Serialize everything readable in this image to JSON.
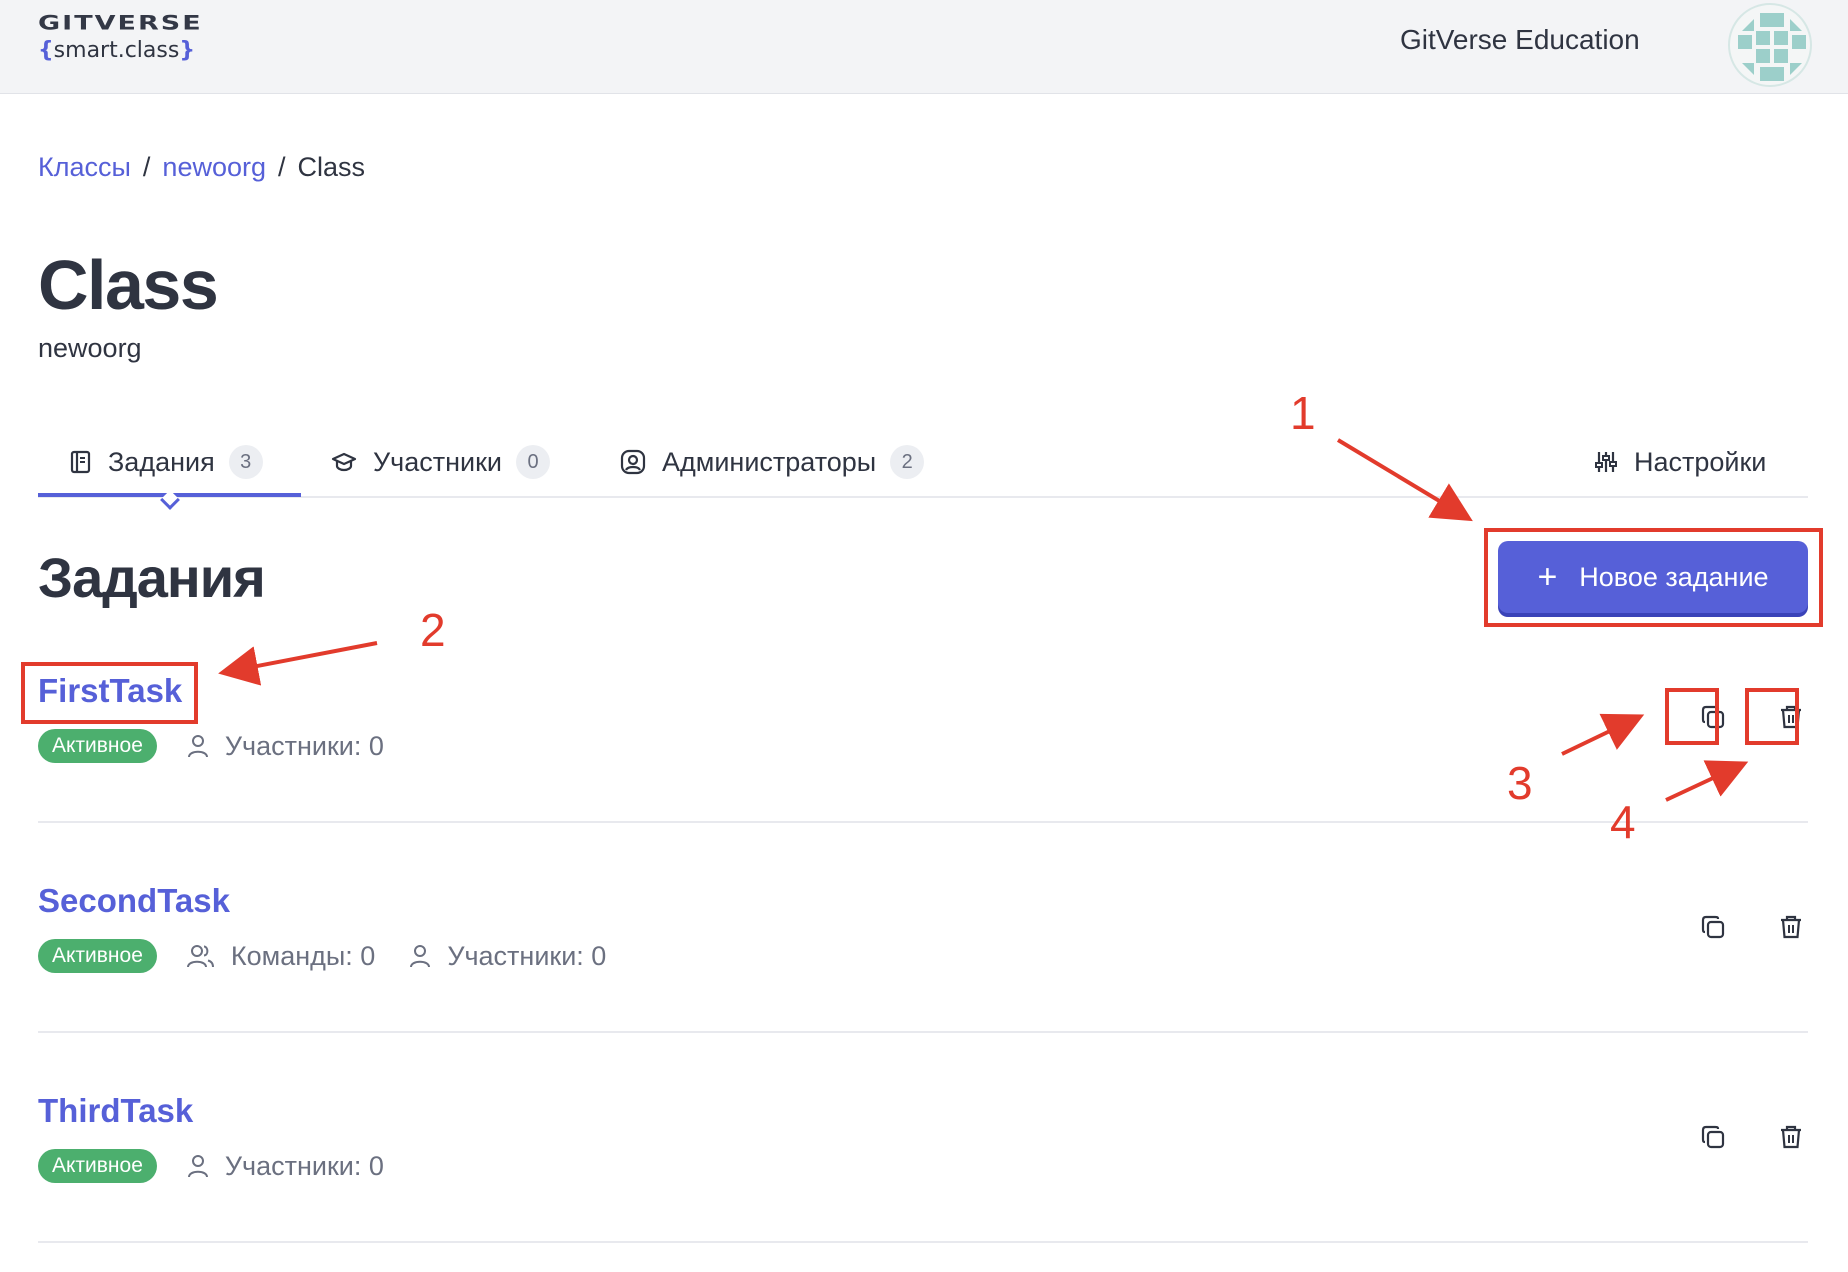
{
  "header": {
    "logo_title": "GITVERSE",
    "logo_sub": "smart.class",
    "logo_brace_open": "{",
    "logo_brace_close": "}",
    "org_name": "GitVerse Education"
  },
  "breadcrumb": {
    "items": [
      "Классы",
      "newoorg",
      "Class"
    ],
    "separator": "/"
  },
  "page": {
    "title": "Class",
    "subtitle": "newoorg"
  },
  "tabs": [
    {
      "label": "Задания",
      "count": "3",
      "icon": "book-icon",
      "active": true
    },
    {
      "label": "Участники",
      "count": "0",
      "icon": "graduation-cap-icon",
      "active": false
    },
    {
      "label": "Администраторы",
      "count": "2",
      "icon": "user-circle-icon",
      "active": false
    }
  ],
  "settings_tab": {
    "label": "Настройки",
    "icon": "sliders-icon"
  },
  "section": {
    "title": "Задания"
  },
  "new_button": {
    "plus": "+",
    "label": "Новое задание"
  },
  "assignments": [
    {
      "name": "FirstTask",
      "status": "Активное",
      "participants": "Участники: 0"
    },
    {
      "name": "SecondTask",
      "status": "Активное",
      "teams": "Команды: 0",
      "participants": "Участники: 0"
    },
    {
      "name": "ThirdTask",
      "status": "Активное",
      "participants": "Участники: 0"
    }
  ],
  "annotations": {
    "numbers": [
      "1",
      "2",
      "3",
      "4"
    ],
    "color": "#e23b2c"
  },
  "colors": {
    "accent": "#5660d8",
    "status_active": "#4caf6e",
    "text": "#2f3441",
    "header_bg": "#f3f4f6"
  }
}
